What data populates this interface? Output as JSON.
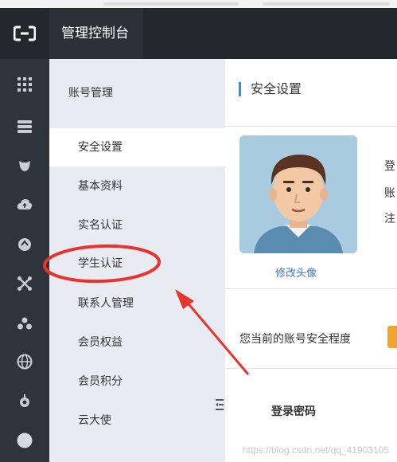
{
  "header": {
    "title": "管理控制台",
    "logo_icon": "aliyun-logo-icon"
  },
  "rail": {
    "icons": [
      "grid-icon",
      "server-icon",
      "dog-face-icon",
      "cloud-upload-icon",
      "circle-arrow-icon",
      "network-icon",
      "cluster-icon",
      "globe-icon",
      "gear-hand-icon",
      "circle-icon"
    ]
  },
  "subnav": {
    "title": "账号管理",
    "items": [
      {
        "label": "安全设置",
        "active": true
      },
      {
        "label": "基本资料"
      },
      {
        "label": "实名认证"
      },
      {
        "label": "学生认证"
      },
      {
        "label": "联系人管理"
      },
      {
        "label": "会员权益"
      },
      {
        "label": "会员积分"
      },
      {
        "label": "云大使"
      }
    ]
  },
  "main": {
    "title": "安全设置",
    "edit_avatar": "修改头像",
    "info_lines": [
      "登",
      "账",
      "注"
    ],
    "security_level_label": "您当前的账号安全程度",
    "password_label": "登录密码"
  },
  "watermark": "https://blog.csdn.net/qq_41903105",
  "colors": {
    "accent": "#3a88d8",
    "annotation": "#e8332f",
    "warning": "#f0a52c"
  }
}
